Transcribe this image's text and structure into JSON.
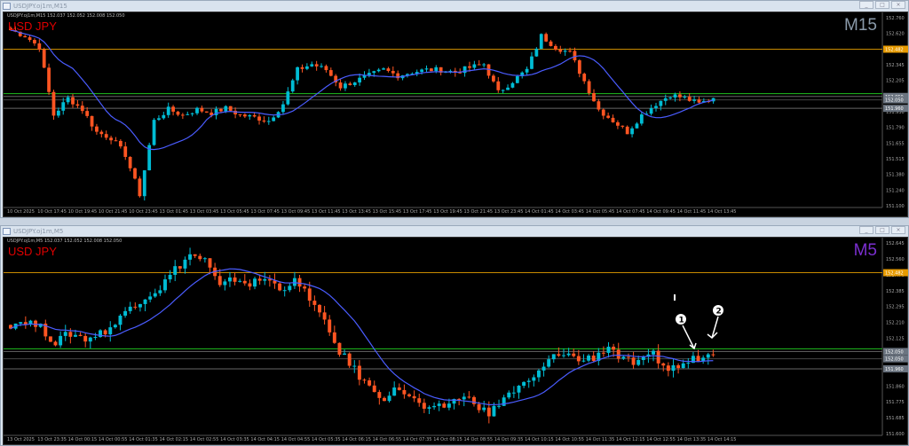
{
  "windows": [
    {
      "title": "USDJPY.oj1m,M15",
      "info": "USDJPY.oj1m,M15  152.037 152.052 152.008 152.050",
      "symbol_label": "USD JPY",
      "timeframe_label": "M15",
      "timeframe_color": "#8a9aaa",
      "price_ticks": [
        "152.760",
        "152.620",
        "152.485",
        "152.345",
        "152.205",
        "152.065",
        "151.930",
        "151.790",
        "151.655",
        "151.515",
        "151.380",
        "151.240",
        "151.100"
      ],
      "price_range": [
        151.1,
        152.76
      ],
      "levels": [
        {
          "price": 152.482,
          "label": "152.482",
          "color": "#c88a00"
        },
        {
          "price": 152.09,
          "label": "",
          "color": "#1fbf1f"
        },
        {
          "price": 152.065,
          "label": "152.050",
          "color": "#666"
        },
        {
          "price": 152.035,
          "label": "152.050",
          "color": "#444"
        },
        {
          "price": 151.96,
          "label": "151.960",
          "color": "#666"
        }
      ],
      "time_labels": [
        "10 Oct 2025",
        "10 Oct 17:45",
        "10 Oct 19:45",
        "10 Oct 21:45",
        "10 Oct 23:45",
        "13 Oct 01:45",
        "13 Oct 03:45",
        "13 Oct 05:45",
        "13 Oct 07:45",
        "13 Oct 09:45",
        "13 Oct 11:45",
        "13 Oct 13:45",
        "13 Oct 15:45",
        "13 Oct 17:45",
        "13 Oct 19:45",
        "13 Oct 21:45",
        "13 Oct 23:45",
        "14 Oct 01:45",
        "14 Oct 03:45",
        "14 Oct 05:45",
        "14 Oct 07:45",
        "14 Oct 09:45",
        "14 Oct 11:45",
        "14 Oct 13:45"
      ],
      "closes": [
        152.65,
        152.6,
        152.5,
        151.9,
        152.05,
        151.95,
        151.75,
        151.7,
        151.55,
        151.2,
        151.85,
        151.95,
        151.9,
        151.95,
        151.92,
        151.96,
        151.9,
        151.88,
        151.85,
        152.0,
        152.3,
        152.35,
        152.3,
        152.15,
        152.2,
        152.25,
        152.3,
        152.25,
        152.28,
        152.3,
        152.3,
        152.28,
        152.32,
        152.35,
        152.1,
        152.2,
        152.3,
        152.6,
        152.5,
        152.45,
        152.2,
        151.95,
        151.85,
        151.75,
        151.9,
        152.0,
        152.08,
        152.05,
        152.0,
        152.05
      ],
      "ma_color": "#4a5cff",
      "bull_color": "#00bcd4",
      "bear_color": "#ff5522"
    },
    {
      "title": "USDJPY.oj1m,M5",
      "info": "USDJPY.oj1m,M5  152.037 152.052 152.008 152.050",
      "symbol_label": "USD JPY",
      "timeframe_label": "M5",
      "timeframe_color": "#7b2fd0",
      "price_ticks": [
        "152.645",
        "152.560",
        "152.470",
        "152.385",
        "152.295",
        "152.210",
        "152.125",
        "152.040",
        "151.955",
        "151.860",
        "151.775",
        "151.685",
        "151.600"
      ],
      "price_range": [
        151.6,
        152.645
      ],
      "levels": [
        {
          "price": 152.482,
          "label": "152.482",
          "color": "#c88a00"
        },
        {
          "price": 152.065,
          "label": "",
          "color": "#1fbf1f"
        },
        {
          "price": 152.05,
          "label": "152.050",
          "color": "#666"
        },
        {
          "price": 152.01,
          "label": "152.050",
          "color": "#444"
        },
        {
          "price": 151.955,
          "label": "151.960",
          "color": "#666"
        }
      ],
      "time_labels": [
        "13 Oct 2025",
        "13 Oct 23:35",
        "14 Oct 00:15",
        "14 Oct 00:55",
        "14 Oct 01:35",
        "14 Oct 02:15",
        "14 Oct 02:55",
        "14 Oct 03:35",
        "14 Oct 04:15",
        "14 Oct 04:55",
        "14 Oct 05:35",
        "14 Oct 06:15",
        "14 Oct 06:55",
        "14 Oct 07:35",
        "14 Oct 08:15",
        "14 Oct 08:55",
        "14 Oct 09:35",
        "14 Oct 10:15",
        "14 Oct 10:55",
        "14 Oct 11:35",
        "14 Oct 12:15",
        "14 Oct 12:55",
        "14 Oct 13:35",
        "14 Oct 14:15"
      ],
      "closes": [
        152.2,
        152.22,
        152.18,
        152.1,
        152.15,
        152.12,
        152.15,
        152.2,
        152.3,
        152.35,
        152.4,
        152.5,
        152.58,
        152.55,
        152.4,
        152.45,
        152.42,
        152.45,
        152.4,
        152.43,
        152.35,
        152.2,
        152.05,
        151.95,
        151.85,
        151.8,
        151.85,
        151.78,
        151.72,
        151.75,
        151.8,
        151.78,
        151.7,
        151.8,
        151.85,
        151.9,
        152.0,
        152.05,
        152.0,
        152.02,
        152.08,
        152.0,
        151.98,
        152.03,
        151.95,
        151.98,
        152.02,
        152.03
      ],
      "ma_color": "#4a5cff",
      "bull_color": "#00bcd4",
      "bear_color": "#ff5522",
      "annotations": [
        {
          "label": "1"
        },
        {
          "label": "2"
        }
      ]
    }
  ]
}
